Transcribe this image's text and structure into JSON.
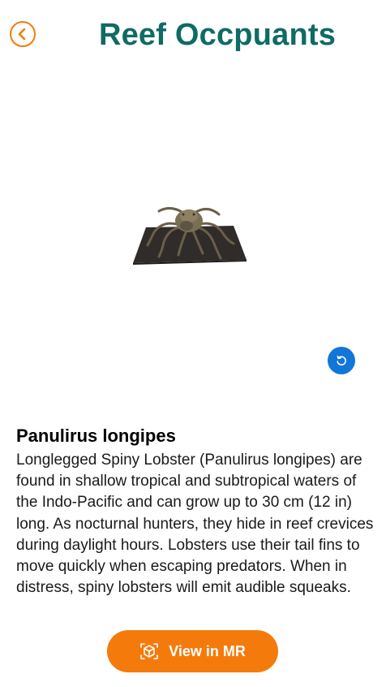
{
  "header": {
    "title": "Reef Occpuants",
    "back_icon": "chevron-left-icon"
  },
  "viewer": {
    "model": "spiny-lobster-3d-model",
    "reset_icon": "rotate-reset-icon"
  },
  "species": {
    "name": "Panulirus longipes",
    "description": "Longlegged Spiny Lobster (Panulirus longipes) are found in shallow tropical and subtropical waters of the Indo-Pacific and can grow up to 30 cm (12 in) long. As nocturnal hunters, they hide in reef crevices during daylight hours. Lobsters use their tail fins to move quickly when escaping predators. When in distress, spiny lobsters will emit audible squeaks."
  },
  "action": {
    "label": "View in MR",
    "icon": "cube-ar-icon"
  },
  "colors": {
    "accent": "#f47b0b",
    "title": "#0f6b64",
    "reset_button": "#1275d8"
  }
}
